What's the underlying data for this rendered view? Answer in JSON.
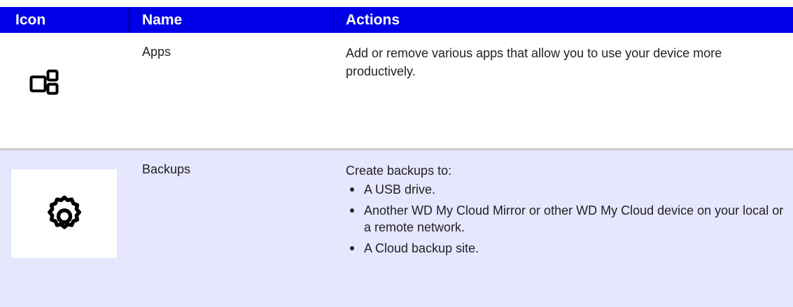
{
  "header": {
    "col_icon": "Icon",
    "col_name": "Name",
    "col_actions": "Actions"
  },
  "rows": [
    {
      "icon": "apps-icon",
      "name": "Apps",
      "action": "Add or remove various apps that allow you to use your device more productively."
    },
    {
      "icon": "gear-icon",
      "name": "Backups",
      "action_intro": "Create backups to:",
      "bullets": [
        "A USB drive.",
        "Another WD My Cloud Mirror or other WD My Cloud device on your local or a remote network.",
        "A Cloud backup site."
      ]
    }
  ],
  "colors": {
    "header_bg": "#0000e6",
    "row_alt_bg": "#e6e6ff"
  }
}
